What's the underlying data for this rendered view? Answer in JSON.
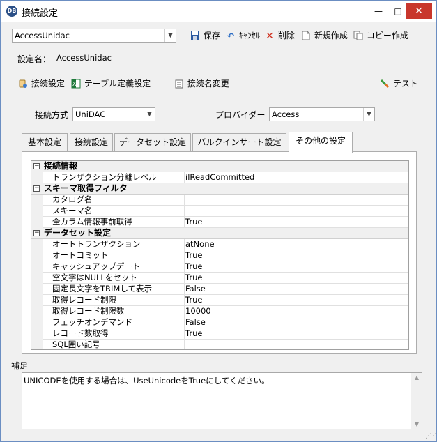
{
  "window": {
    "title": "接続設定",
    "app_icon_text": "DB",
    "controls": {
      "minimize": "—",
      "maximize": "□",
      "close": "✕"
    }
  },
  "toolbar": {
    "connection_select": "AccessUnidac",
    "save_label": "保存",
    "cancel_label": "ｷｬﾝｾﾙ",
    "delete_label": "削除",
    "new_label": "新規作成",
    "copy_label": "コピー作成"
  },
  "setting_name": {
    "label": "設定名：",
    "value": "AccessUnidac"
  },
  "subtoolbar": {
    "connection_settings": "接続設定",
    "table_definition": "テーブル定義設定",
    "rename_connection": "接続名変更",
    "test": "テスト"
  },
  "connection_method": {
    "label": "接続方式",
    "value": "UniDAC"
  },
  "provider": {
    "label": "プロバイダー",
    "value": "Access"
  },
  "tabs": [
    {
      "label": "基本設定",
      "active": false
    },
    {
      "label": "接続設定",
      "active": false
    },
    {
      "label": "データセット設定",
      "active": false
    },
    {
      "label": "バルクインサート設定",
      "active": false
    },
    {
      "label": "その他の設定",
      "active": true
    }
  ],
  "property_grid": {
    "categories": [
      {
        "name": "接続情報",
        "expander": "−",
        "rows": [
          {
            "name": "トランザクション分離レベル",
            "value": "ilReadCommitted"
          }
        ]
      },
      {
        "name": "スキーマ取得フィルタ",
        "expander": "−",
        "rows": [
          {
            "name": "カタログ名",
            "value": ""
          },
          {
            "name": "スキーマ名",
            "value": ""
          },
          {
            "name": "全カラム情報事前取得",
            "value": "True"
          }
        ]
      },
      {
        "name": "データセット設定",
        "expander": "−",
        "rows": [
          {
            "name": "オートトランザクション",
            "value": "atNone"
          },
          {
            "name": "オートコミット",
            "value": "True"
          },
          {
            "name": "キャッシュアップデート",
            "value": "True"
          },
          {
            "name": "空文字はNULLをセット",
            "value": "True"
          },
          {
            "name": "固定長文字をTRIMして表示",
            "value": "False"
          },
          {
            "name": "取得レコード制限",
            "value": "True"
          },
          {
            "name": "取得レコード制限数",
            "value": "10000"
          },
          {
            "name": "フェッチオンデマンド",
            "value": "False"
          },
          {
            "name": "レコード数取得",
            "value": "True"
          },
          {
            "name": "SQL囲い記号",
            "value": ""
          }
        ]
      }
    ]
  },
  "supplement": {
    "label": "補足",
    "text": "UNICODEを使用する場合は、UseUnicodeをTrueにしてください。"
  },
  "icons": {
    "combo_arrow": "▼",
    "scroll_up": "▲",
    "scroll_down": "▼"
  }
}
